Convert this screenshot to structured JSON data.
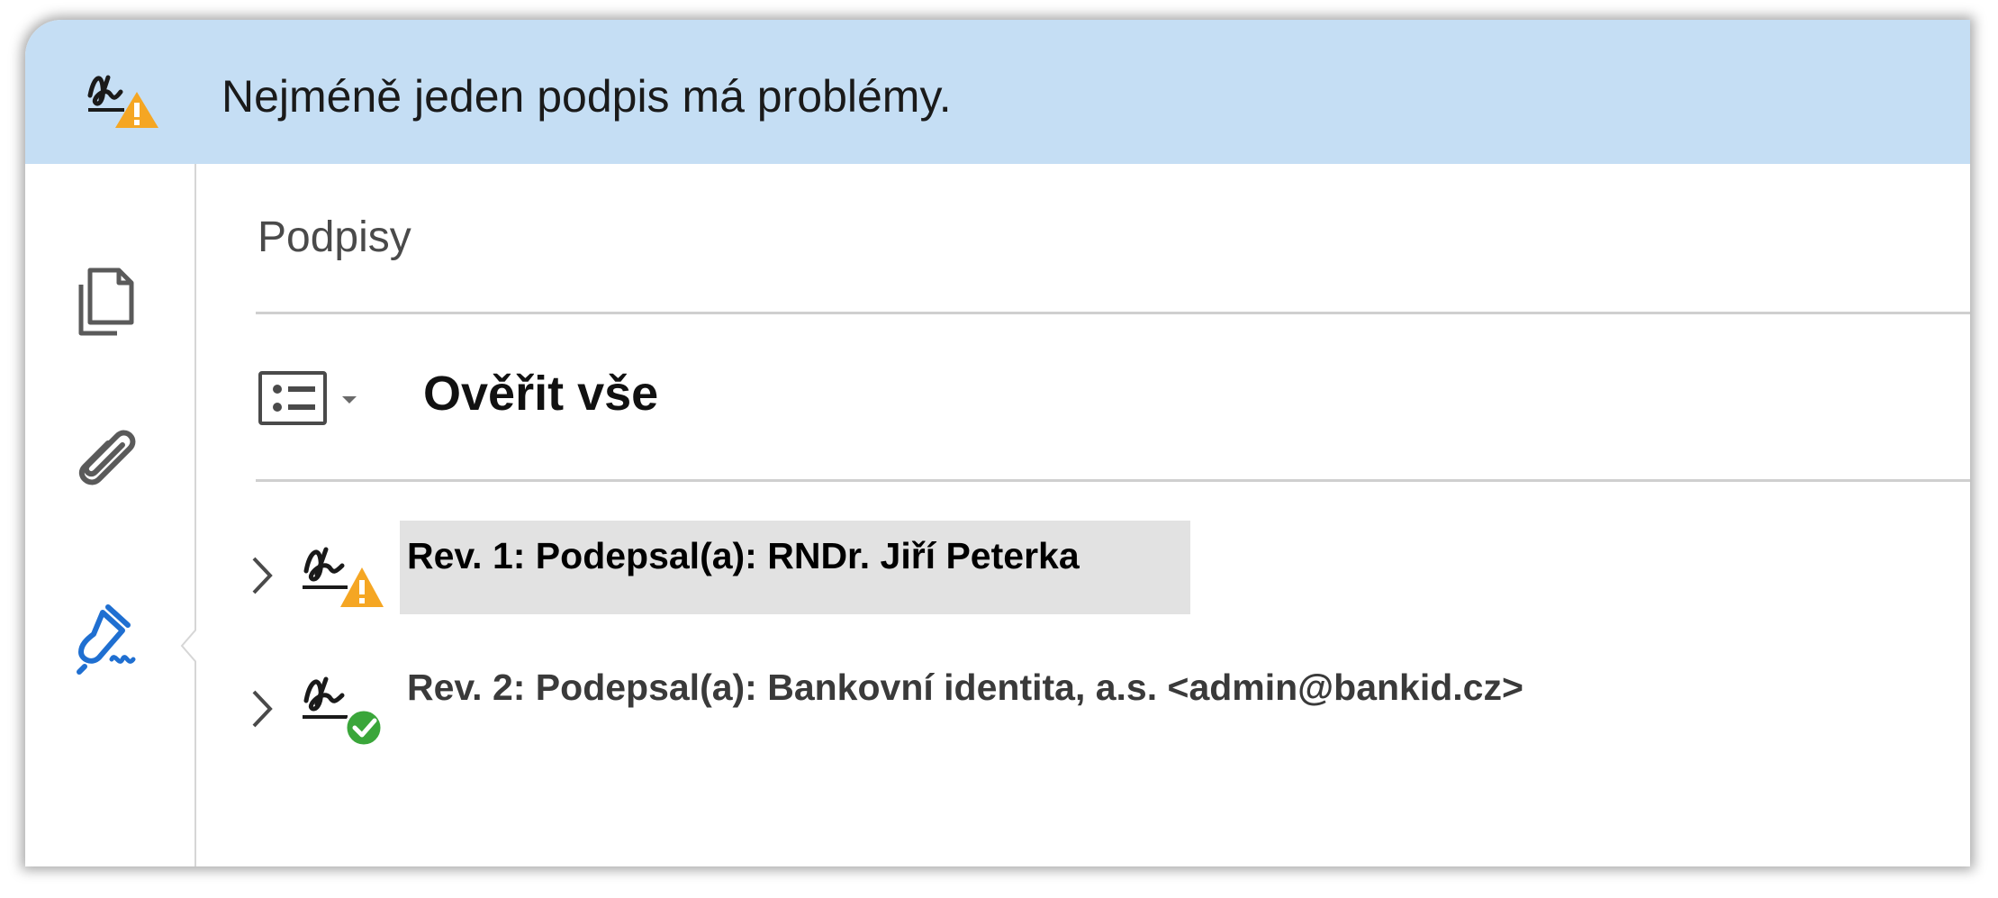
{
  "colors": {
    "banner_bg": "#c5def4",
    "warning": "#f5a623",
    "success": "#3aa63a",
    "accent_blue": "#1f6fd1",
    "selected_row": "#e2e2e2"
  },
  "banner": {
    "icon": "signature-warning-icon",
    "message": "Nejméně jeden podpis má problémy."
  },
  "left_rail": {
    "items": [
      {
        "icon": "pages-icon",
        "active": false
      },
      {
        "icon": "attachment-icon",
        "active": false
      },
      {
        "icon": "signature-pen-icon",
        "active": true
      }
    ]
  },
  "panel": {
    "title": "Podpisy",
    "toolbar": {
      "options_icon": "options-list-icon",
      "verify_all_label": "Ověřit vše"
    },
    "signatures": [
      {
        "label": "Rev. 1: Podepsal(a): RNDr. Jiří Peterka",
        "status_icon": "signature-warning-icon",
        "selected": true
      },
      {
        "label": "Rev. 2: Podepsal(a): Bankovní identita, a.s. <admin@bankid.cz>",
        "status_icon": "signature-valid-icon",
        "selected": false
      }
    ]
  }
}
